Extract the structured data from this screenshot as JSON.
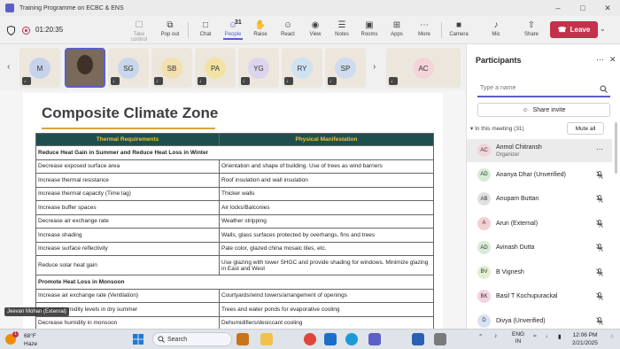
{
  "window": {
    "title": "Training Programme on ECBC & ENS"
  },
  "toolbar": {
    "timer": "01:20:35",
    "buttons": [
      {
        "label": "Take control",
        "icon": "take-control-icon",
        "glyph": "☐",
        "state": "dim"
      },
      {
        "label": "Pop out",
        "icon": "pop-out-icon",
        "glyph": "⧉",
        "state": ""
      },
      {
        "label": "Chat",
        "icon": "chat-icon",
        "glyph": "⚇",
        "state": ""
      },
      {
        "label": "People",
        "icon": "people-icon",
        "glyph": "☺",
        "state": "active",
        "count": "31"
      },
      {
        "label": "Raise",
        "icon": "raise-hand-icon",
        "glyph": "✋",
        "state": ""
      },
      {
        "label": "React",
        "icon": "react-icon",
        "glyph": "☺",
        "state": ""
      },
      {
        "label": "View",
        "icon": "view-icon",
        "glyph": "◉",
        "state": ""
      },
      {
        "label": "Notes",
        "icon": "notes-icon",
        "glyph": "☰",
        "state": ""
      },
      {
        "label": "Rooms",
        "icon": "rooms-icon",
        "glyph": "▣",
        "state": ""
      },
      {
        "label": "Apps",
        "icon": "apps-icon",
        "glyph": "⊞",
        "state": ""
      },
      {
        "label": "More",
        "icon": "more-icon",
        "glyph": "…",
        "state": ""
      },
      {
        "label": "Camera",
        "icon": "camera-off-icon",
        "glyph": "■",
        "state": ""
      },
      {
        "label": "Mic",
        "icon": "mic-off-icon",
        "glyph": "♩",
        "state": ""
      },
      {
        "label": "Share",
        "icon": "share-icon",
        "glyph": "⇧",
        "state": ""
      }
    ],
    "leave_label": "Leave"
  },
  "gallery": {
    "tiles": [
      {
        "initials": "M",
        "color": "#c7d3ea"
      },
      {
        "initials": "",
        "color": "#7a6a5a",
        "video": true
      },
      {
        "initials": "SG",
        "color": "#c8d7eb"
      },
      {
        "initials": "SB",
        "color": "#f3e0b0"
      },
      {
        "initials": "PA",
        "color": "#f3e3a2"
      },
      {
        "initials": "YG",
        "color": "#ddd4ef"
      },
      {
        "initials": "RY",
        "color": "#cfe2f2"
      },
      {
        "initials": "SP",
        "color": "#cfdcef"
      },
      {
        "initials": "AC",
        "color": "#f2d4d9"
      }
    ]
  },
  "slide": {
    "title": "Composite Climate Zone",
    "headers": [
      "Thermal Requirements",
      "Physical Manifestation"
    ],
    "section1": "Reduce Heat Gain in Summer and Reduce Heat Loss in Winter",
    "rows1": [
      [
        "Decrease exposed surface area",
        "Orientation and shape of building. Use of trees as wind barriers"
      ],
      [
        "Increase thermal resistance",
        "Roof insulation and wall insulation"
      ],
      [
        "Increase thermal capacity (Time lag)",
        "Thicker walls"
      ],
      [
        "Increase buffer spaces",
        "Air locks/Balconies"
      ],
      [
        "Decrease air exchange rate",
        "Weather stripping"
      ],
      [
        "Increase shading",
        "Walls, glass surfaces protected by overhangs, fins and trees"
      ],
      [
        "Increase surface reflectivity",
        "Pale color, glazed china mosaic tiles, etc."
      ],
      [
        "Reduce solar heat gain",
        "Use glazing with lower SHGC and provide shading for windows. Minimize glazing in East and West"
      ]
    ],
    "section2": "Promote Heat Loss in Monsoon",
    "rows2": [
      [
        "Increase air exchange rate (Ventilation)",
        "Courtyards/wind towers/arrangement of openings"
      ],
      [
        "Increase humidity levels in dry summer",
        "Trees and water ponds for evaporative cooling"
      ],
      [
        "Decrease humidity in monsoon",
        "Dehumidifiers/desiccant cooling"
      ]
    ],
    "name_tag": "Jeevan Mohan (External)"
  },
  "panel": {
    "title": "Participants",
    "search_placeholder": "Type a name",
    "share_invite": "Share invite",
    "in_meeting": "In this meeting (31)",
    "mute_all": "Mute all",
    "participants": [
      {
        "initials": "AC",
        "name": "Anmol Chitransh",
        "role": "Organizer",
        "color": "#f2d4d9"
      },
      {
        "initials": "AD",
        "name": "Ananya Dhar (Unverified)",
        "role": "",
        "color": "#d7ecd6"
      },
      {
        "initials": "AB",
        "name": "Anupam Buttan",
        "role": "",
        "color": "#e1e1e1"
      },
      {
        "initials": "A",
        "name": "Arun (External)",
        "role": "",
        "color": "#f3d0d0"
      },
      {
        "initials": "AD",
        "name": "Avinash Dutta",
        "role": "",
        "color": "#d7ecd6"
      },
      {
        "initials": "BV",
        "name": "B Vignesh",
        "role": "",
        "color": "#e0f0d2"
      },
      {
        "initials": "BK",
        "name": "Basil T Kochupurackal",
        "role": "",
        "color": "#f3d4e2"
      },
      {
        "initials": "D",
        "name": "Divya (Unverified)",
        "role": "",
        "color": "#d9e2f3"
      }
    ]
  },
  "taskbar": {
    "weather_temp": "68°F",
    "weather_desc": "Haze",
    "weather_badge": "1",
    "search_label": "Search",
    "lang": "ENG",
    "region": "IN",
    "time": "12:06 PM",
    "date": "2/21/2025",
    "apps": [
      {
        "icon": "briefcase-app-icon",
        "color": "#c8741a"
      },
      {
        "icon": "file-explorer-icon",
        "color": "#f2c14e"
      },
      {
        "icon": "chrome-icon",
        "color": "#e2463a"
      },
      {
        "icon": "outlook-icon",
        "color": "#1b6fc9"
      },
      {
        "icon": "edge-icon",
        "color": "#1a9bd7"
      },
      {
        "icon": "teams-icon",
        "color": "#5b5fc7"
      },
      {
        "icon": "word-icon",
        "color": "#2b5fb3"
      },
      {
        "icon": "settings-icon",
        "color": "#7a7a7a"
      }
    ]
  }
}
